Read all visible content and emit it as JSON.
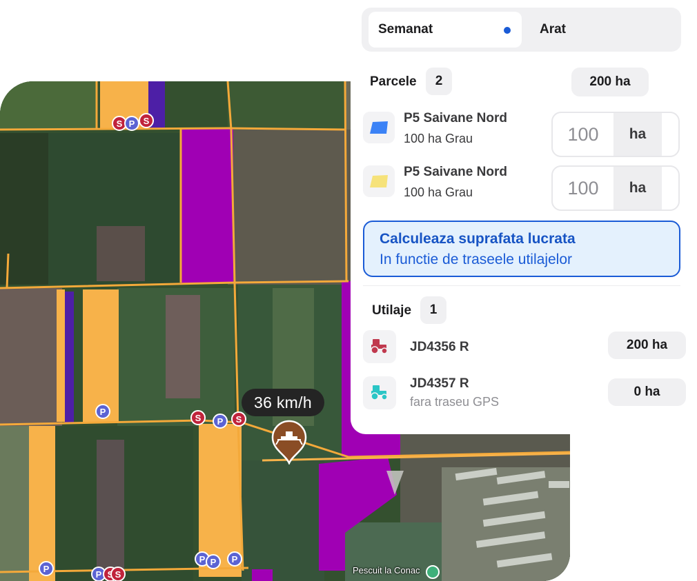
{
  "map": {
    "speed": "36 km/h",
    "poi_label": "Pescuit la Conac",
    "markers": [
      "S",
      "P",
      "S",
      "P",
      "S",
      "P",
      "S",
      "P",
      "P",
      "P",
      "P",
      "P",
      "S",
      "S"
    ]
  },
  "tabs": {
    "active": "Semanat",
    "inactive": "Arat"
  },
  "parcels": {
    "title": "Parcele",
    "count": "2",
    "total": "200 ha",
    "items": [
      {
        "name": "P5 Saivane Nord",
        "detail": "100 ha Grau",
        "value": "100",
        "unit": "ha",
        "color": "#3b82f6"
      },
      {
        "name": "P5 Saivane Nord",
        "detail": "100 ha Grau",
        "value": "100",
        "unit": "ha",
        "color": "#f6e27a"
      }
    ]
  },
  "calculate": {
    "title": "Calculeaza suprafata lucrata",
    "subtitle": "In functie de traseele utilajelor"
  },
  "equipment": {
    "title": "Utilaje",
    "count": "1",
    "items": [
      {
        "name": "JD4356 R",
        "detail": "",
        "area": "200 ha",
        "color": "#c0394e"
      },
      {
        "name": "JD4357 R",
        "detail": "fara traseu GPS",
        "area": "0 ha",
        "color": "#2bc6c6"
      }
    ]
  },
  "colors": {
    "accent": "#1a5bd6",
    "field_orange": "#f7b24a",
    "field_magenta": "#a000b4",
    "pin_brown": "#8a4d25"
  }
}
